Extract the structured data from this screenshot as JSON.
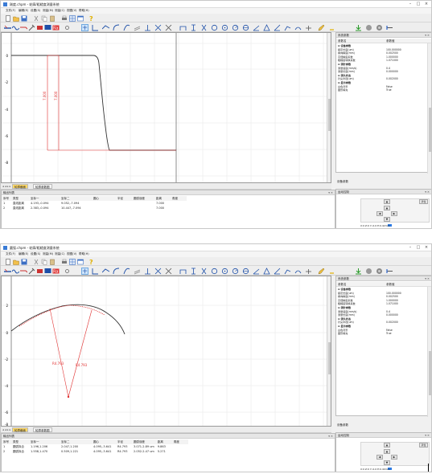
{
  "windows": [
    {
      "title": "刚度.chpm - 轮廓/粗糙度测量系统",
      "menu": [
        "文件(F)",
        "编辑(E)",
        "设置(S)",
        "测量(M)",
        "测量(C)",
        "视图(V)",
        "帮助(H)"
      ],
      "canvas_axis_labels": [
        "0",
        "-2",
        "-4",
        "-6",
        "-8"
      ],
      "dim_labels": [
        "7.000",
        "7.000"
      ],
      "tabs": [
        "轮廓截面",
        "轮廓参数图"
      ],
      "output": {
        "title": "输出列表",
        "headers": [
          "序号",
          "类型",
          "坐标一",
          "坐标二",
          "圆心",
          "半径",
          "圆弧误差",
          "距离",
          "角度"
        ],
        "rows": [
          [
            "1",
            "直线距离",
            "4.193,-0.094",
            "9.052,-7.094",
            "",
            "",
            "",
            "7.000",
            ""
          ],
          [
            "2",
            "直线距离",
            "2.383,-0.094",
            "10.447,-7.094",
            "",
            "",
            "",
            "7.000",
            ""
          ]
        ]
      }
    },
    {
      "title": "圆弧.chpm - 轮廓/粗糙度测量系统",
      "menu": [
        "文件(F)",
        "编辑(E)",
        "设置(S)",
        "测量(M)",
        "测量(C)",
        "视图(V)",
        "帮助(H)"
      ],
      "canvas_axis_labels": [
        "2",
        "0",
        "-2",
        "-4",
        "-6",
        "-8"
      ],
      "dim_labels": [
        "R4.793",
        "R4.793"
      ],
      "tabs": [
        "轮廓截面",
        "轮廓参数图"
      ],
      "output": {
        "title": "输出列表",
        "headers": [
          "序号",
          "类型",
          "坐标一",
          "坐标二",
          "圆心",
          "半径",
          "圆弧误差",
          "距离",
          "角度"
        ],
        "rows": [
          [
            "1",
            "圆弧拟合",
            "1.196,1.206",
            "2.047,1.200",
            "4.095,-3.641",
            "R4.793",
            "3.071-2.89 um",
            "9.863",
            ""
          ],
          [
            "2",
            "圆弧拟合",
            "1.558,1.470",
            "0.509,1.221",
            "4.095,-3.641",
            "R4.793",
            "2.052-2.47 um",
            "5.271",
            ""
          ]
        ]
      }
    }
  ],
  "properties": {
    "title": "系统参数",
    "col_name": "参数名",
    "col_value": "参数值",
    "rows": [
      {
        "k": "⊟ 设备参数",
        "v": "",
        "cat": true
      },
      {
        "k": "额定长度(um)",
        "v": "100.000000"
      },
      {
        "k": "横向精度(mm)",
        "v": "0.002500"
      },
      {
        "k": "高倍精度系数",
        "v": "1.000000"
      },
      {
        "k": "粗糙度转换系数",
        "v": "1.071000"
      },
      {
        "k": "⊟ 测针参数",
        "v": "",
        "cat": true
      },
      {
        "k": "测量速度(mm/s)",
        "v": "0.4"
      },
      {
        "k": "测量长度(mm)",
        "v": "0.000000"
      },
      {
        "k": "⊟ 测头状态",
        "v": "",
        "cat": true
      },
      {
        "k": "针尖半径(um)",
        "v": "0.002000"
      },
      {
        "k": "⊟ 显示参数",
        "v": "",
        "cat": true
      },
      {
        "k": "白色背景",
        "v": "False"
      },
      {
        "k": "图形填充",
        "v": "True"
      }
    ],
    "description_title": "设备参数"
  },
  "control": {
    "title": "运动控制",
    "zero_label": "清位",
    "arrows": [
      "▲",
      "▲",
      "◀",
      "▶",
      "▼"
    ],
    "position": "X:0  Z:0  Y:-0.0  E:0.42mm",
    "position2": "X:0  Z:0  Y:-0.0  E:0.40mm"
  },
  "chart_data": [
    {
      "type": "line",
      "y_ticks": [
        0,
        -2,
        -4,
        -6,
        -8
      ],
      "series": [
        {
          "x": [
            0,
            4.2,
            4.5,
            4.9,
            5.3,
            5.8,
            6.4
          ],
          "y": [
            0,
            0,
            -0.1,
            -1.2,
            -4.2,
            -6.6,
            -7.1
          ]
        }
      ],
      "annotations": [
        "7.000",
        "7.000"
      ]
    },
    {
      "type": "line",
      "y_ticks": [
        2,
        0,
        -2,
        -4,
        -6,
        -8
      ],
      "series": [
        {
          "x": [
            0,
            2,
            4,
            6,
            8,
            10
          ],
          "y": [
            0.2,
            1.6,
            2.2,
            2.1,
            1.3,
            -0.3
          ]
        }
      ],
      "annotations": [
        "R4.793",
        "R4.793"
      ]
    }
  ]
}
